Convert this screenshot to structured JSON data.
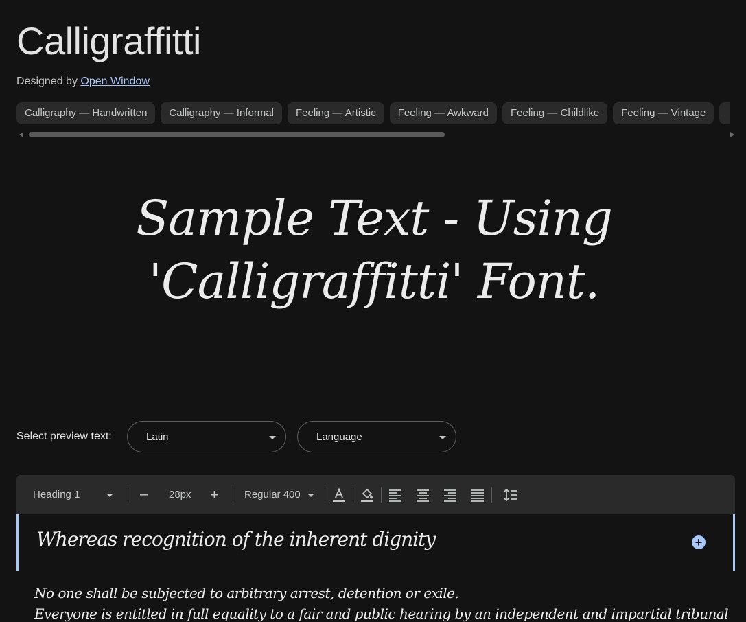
{
  "font": {
    "title": "Calligraffitti",
    "designed_by_label": "Designed by",
    "designer": "Open Window"
  },
  "tags": [
    "Calligraphy — Handwritten",
    "Calligraphy — Informal",
    "Feeling — Artistic",
    "Feeling — Awkward",
    "Feeling — Childlike",
    "Feeling — Vintage"
  ],
  "sample_text": "Sample Text - Using 'Calligraffitti' Font.",
  "preview_controls": {
    "label": "Select preview text:",
    "script_value": "Latin",
    "language_placeholder": "Language"
  },
  "toolbar": {
    "style_value": "Heading 1",
    "size_value": "28px",
    "weight_value": "Regular 400",
    "minus": "–",
    "plus": "+"
  },
  "previews": {
    "heading": "Whereas recognition of the inherent dignity",
    "line2": "No one shall be subjected to arbitrary arrest, detention or exile.",
    "line3": "Everyone is entitled in full equality to a fair and public hearing by an independent and impartial tribunal"
  },
  "colors": {
    "background": "#131314",
    "accent": "#a8c7fa",
    "chip": "#2a2a2b"
  }
}
